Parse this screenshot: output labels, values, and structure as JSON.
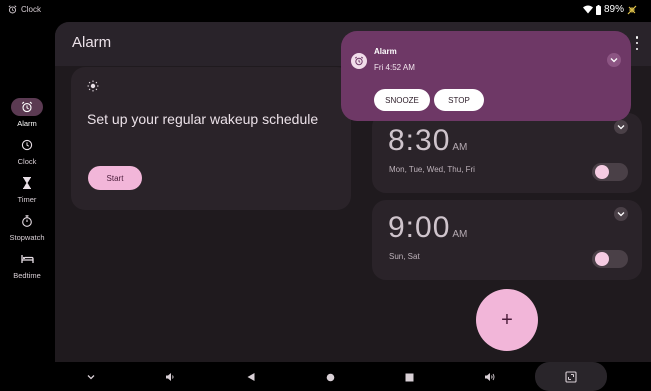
{
  "status_bar": {
    "app_name": "Clock",
    "battery": "89%"
  },
  "rail": {
    "items": [
      {
        "label": "Alarm",
        "icon": "alarm-icon",
        "active": true
      },
      {
        "label": "Clock",
        "icon": "clock-icon",
        "active": false
      },
      {
        "label": "Timer",
        "icon": "hourglass-icon",
        "active": false
      },
      {
        "label": "Stopwatch",
        "icon": "stopwatch-icon",
        "active": false
      },
      {
        "label": "Bedtime",
        "icon": "bed-icon",
        "active": false
      }
    ]
  },
  "header": {
    "title": "Alarm"
  },
  "wakeup_card": {
    "icon": "sun-icon",
    "text": "Set up your regular wakeup schedule",
    "start_label": "Start"
  },
  "alarms": [
    {
      "time": "8:30",
      "ampm": "AM",
      "days": "Mon, Tue, Wed, Thu, Fri",
      "enabled": false
    },
    {
      "time": "9:00",
      "ampm": "AM",
      "days": "Sun, Sat",
      "enabled": false
    }
  ],
  "fab": {
    "label": "+"
  },
  "notification": {
    "title": "Alarm",
    "subtitle": "Fri 4:52 AM",
    "snooze_label": "SNOOZE",
    "stop_label": "STOP"
  },
  "colors": {
    "accent": "#f2b6d9",
    "notification_bg": "#6e3866",
    "surface": "#2a2329",
    "background": "#1f1a1e"
  }
}
